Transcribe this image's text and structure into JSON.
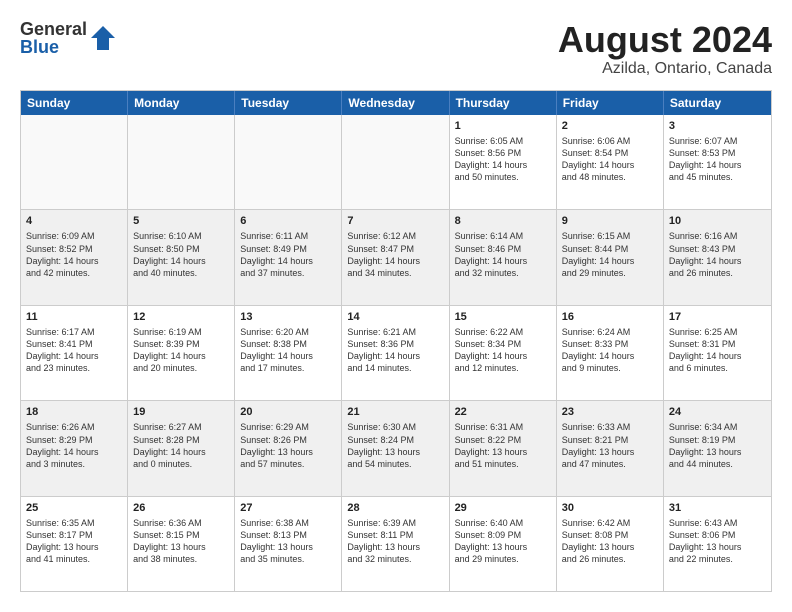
{
  "logo": {
    "general": "General",
    "blue": "Blue"
  },
  "title": "August 2024",
  "subtitle": "Azilda, Ontario, Canada",
  "header_days": [
    "Sunday",
    "Monday",
    "Tuesday",
    "Wednesday",
    "Thursday",
    "Friday",
    "Saturday"
  ],
  "weeks": [
    [
      {
        "day": "",
        "info": "",
        "shaded": true
      },
      {
        "day": "",
        "info": "",
        "shaded": true
      },
      {
        "day": "",
        "info": "",
        "shaded": true
      },
      {
        "day": "",
        "info": "",
        "shaded": true
      },
      {
        "day": "1",
        "info": "Sunrise: 6:05 AM\nSunset: 8:56 PM\nDaylight: 14 hours\nand 50 minutes.",
        "shaded": false
      },
      {
        "day": "2",
        "info": "Sunrise: 6:06 AM\nSunset: 8:54 PM\nDaylight: 14 hours\nand 48 minutes.",
        "shaded": false
      },
      {
        "day": "3",
        "info": "Sunrise: 6:07 AM\nSunset: 8:53 PM\nDaylight: 14 hours\nand 45 minutes.",
        "shaded": false
      }
    ],
    [
      {
        "day": "4",
        "info": "Sunrise: 6:09 AM\nSunset: 8:52 PM\nDaylight: 14 hours\nand 42 minutes.",
        "shaded": true
      },
      {
        "day": "5",
        "info": "Sunrise: 6:10 AM\nSunset: 8:50 PM\nDaylight: 14 hours\nand 40 minutes.",
        "shaded": true
      },
      {
        "day": "6",
        "info": "Sunrise: 6:11 AM\nSunset: 8:49 PM\nDaylight: 14 hours\nand 37 minutes.",
        "shaded": true
      },
      {
        "day": "7",
        "info": "Sunrise: 6:12 AM\nSunset: 8:47 PM\nDaylight: 14 hours\nand 34 minutes.",
        "shaded": true
      },
      {
        "day": "8",
        "info": "Sunrise: 6:14 AM\nSunset: 8:46 PM\nDaylight: 14 hours\nand 32 minutes.",
        "shaded": true
      },
      {
        "day": "9",
        "info": "Sunrise: 6:15 AM\nSunset: 8:44 PM\nDaylight: 14 hours\nand 29 minutes.",
        "shaded": true
      },
      {
        "day": "10",
        "info": "Sunrise: 6:16 AM\nSunset: 8:43 PM\nDaylight: 14 hours\nand 26 minutes.",
        "shaded": true
      }
    ],
    [
      {
        "day": "11",
        "info": "Sunrise: 6:17 AM\nSunset: 8:41 PM\nDaylight: 14 hours\nand 23 minutes.",
        "shaded": false
      },
      {
        "day": "12",
        "info": "Sunrise: 6:19 AM\nSunset: 8:39 PM\nDaylight: 14 hours\nand 20 minutes.",
        "shaded": false
      },
      {
        "day": "13",
        "info": "Sunrise: 6:20 AM\nSunset: 8:38 PM\nDaylight: 14 hours\nand 17 minutes.",
        "shaded": false
      },
      {
        "day": "14",
        "info": "Sunrise: 6:21 AM\nSunset: 8:36 PM\nDaylight: 14 hours\nand 14 minutes.",
        "shaded": false
      },
      {
        "day": "15",
        "info": "Sunrise: 6:22 AM\nSunset: 8:34 PM\nDaylight: 14 hours\nand 12 minutes.",
        "shaded": false
      },
      {
        "day": "16",
        "info": "Sunrise: 6:24 AM\nSunset: 8:33 PM\nDaylight: 14 hours\nand 9 minutes.",
        "shaded": false
      },
      {
        "day": "17",
        "info": "Sunrise: 6:25 AM\nSunset: 8:31 PM\nDaylight: 14 hours\nand 6 minutes.",
        "shaded": false
      }
    ],
    [
      {
        "day": "18",
        "info": "Sunrise: 6:26 AM\nSunset: 8:29 PM\nDaylight: 14 hours\nand 3 minutes.",
        "shaded": true
      },
      {
        "day": "19",
        "info": "Sunrise: 6:27 AM\nSunset: 8:28 PM\nDaylight: 14 hours\nand 0 minutes.",
        "shaded": true
      },
      {
        "day": "20",
        "info": "Sunrise: 6:29 AM\nSunset: 8:26 PM\nDaylight: 13 hours\nand 57 minutes.",
        "shaded": true
      },
      {
        "day": "21",
        "info": "Sunrise: 6:30 AM\nSunset: 8:24 PM\nDaylight: 13 hours\nand 54 minutes.",
        "shaded": true
      },
      {
        "day": "22",
        "info": "Sunrise: 6:31 AM\nSunset: 8:22 PM\nDaylight: 13 hours\nand 51 minutes.",
        "shaded": true
      },
      {
        "day": "23",
        "info": "Sunrise: 6:33 AM\nSunset: 8:21 PM\nDaylight: 13 hours\nand 47 minutes.",
        "shaded": true
      },
      {
        "day": "24",
        "info": "Sunrise: 6:34 AM\nSunset: 8:19 PM\nDaylight: 13 hours\nand 44 minutes.",
        "shaded": true
      }
    ],
    [
      {
        "day": "25",
        "info": "Sunrise: 6:35 AM\nSunset: 8:17 PM\nDaylight: 13 hours\nand 41 minutes.",
        "shaded": false
      },
      {
        "day": "26",
        "info": "Sunrise: 6:36 AM\nSunset: 8:15 PM\nDaylight: 13 hours\nand 38 minutes.",
        "shaded": false
      },
      {
        "day": "27",
        "info": "Sunrise: 6:38 AM\nSunset: 8:13 PM\nDaylight: 13 hours\nand 35 minutes.",
        "shaded": false
      },
      {
        "day": "28",
        "info": "Sunrise: 6:39 AM\nSunset: 8:11 PM\nDaylight: 13 hours\nand 32 minutes.",
        "shaded": false
      },
      {
        "day": "29",
        "info": "Sunrise: 6:40 AM\nSunset: 8:09 PM\nDaylight: 13 hours\nand 29 minutes.",
        "shaded": false
      },
      {
        "day": "30",
        "info": "Sunrise: 6:42 AM\nSunset: 8:08 PM\nDaylight: 13 hours\nand 26 minutes.",
        "shaded": false
      },
      {
        "day": "31",
        "info": "Sunrise: 6:43 AM\nSunset: 8:06 PM\nDaylight: 13 hours\nand 22 minutes.",
        "shaded": false
      }
    ]
  ]
}
